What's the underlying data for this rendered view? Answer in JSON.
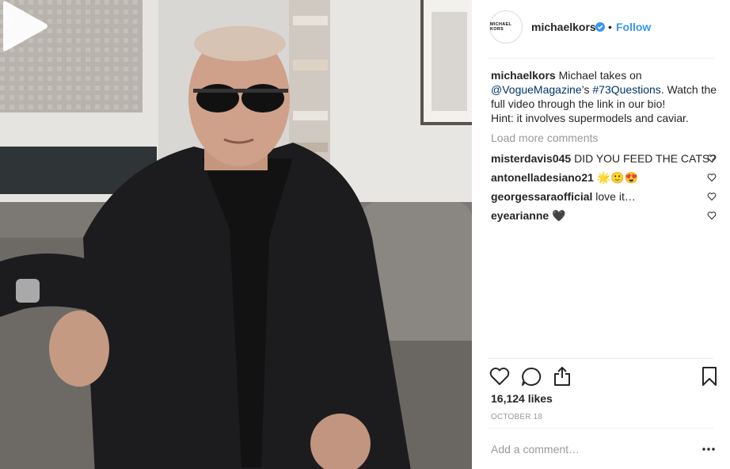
{
  "post": {
    "media": {
      "type": "video",
      "play_icon": "play-icon"
    },
    "header": {
      "avatar_text": "MICHAEL KORS",
      "username": "michaelkors",
      "verified_icon": "verified-badge-icon",
      "separator": "•",
      "follow_label": "Follow"
    },
    "caption": {
      "username": "michaelkors",
      "text_1": " Michael takes on ",
      "mention": "@VogueMagazine",
      "text_2": "’s ",
      "hashtag": "#73Questions",
      "text_3": ". Watch the full video through the link in our bio!",
      "text_4": "Hint: it involves supermodels and caviar."
    },
    "load_more_label": "Load more comments",
    "comments": [
      {
        "user": "misterdavis045",
        "text": "DID YOU FEED THE CATS?"
      },
      {
        "user": "antonelladesiano21",
        "text": "🌟🙂😍"
      },
      {
        "user": "georgessaraofficial",
        "text": "love it…"
      },
      {
        "user": "eyearianne",
        "text": "🖤"
      }
    ],
    "actions": {
      "like_icon": "heart-icon",
      "comment_icon": "comment-icon",
      "share_icon": "share-icon",
      "save_icon": "bookmark-icon"
    },
    "likes_label": "16,124 likes",
    "date": "OCTOBER 18",
    "add_comment_placeholder": "Add a comment…",
    "more_icon": "more-options-icon",
    "colors": {
      "link_blue": "#3897f0",
      "mention": "#003569",
      "muted": "#999999",
      "text": "#262626"
    }
  }
}
